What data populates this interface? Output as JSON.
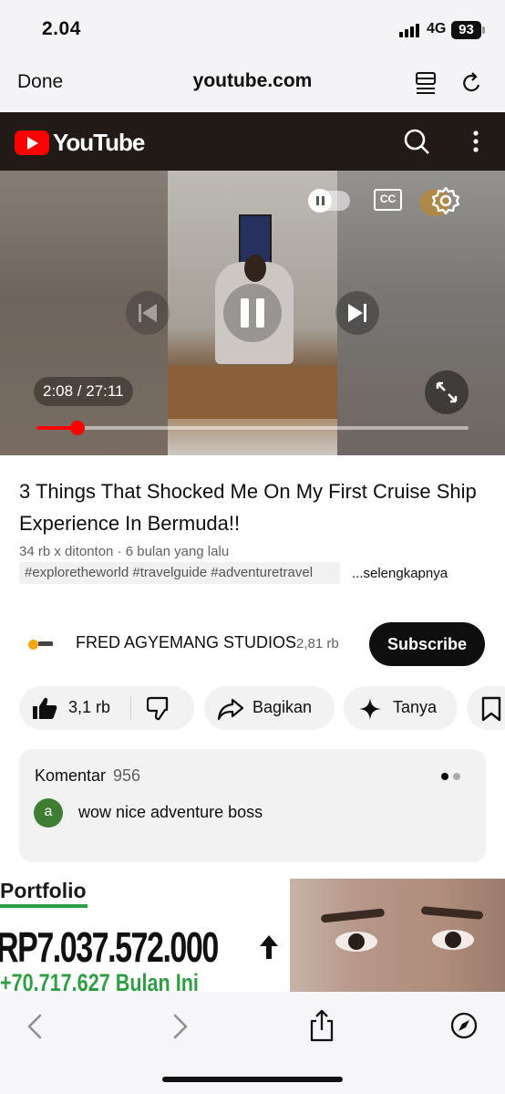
{
  "status_bar": {
    "time": "2.04",
    "network": "4G",
    "battery": "93"
  },
  "browser": {
    "done_label": "Done",
    "url": "youtube.com"
  },
  "youtube_header": {
    "logo_text": "YouTube"
  },
  "player": {
    "time_current": "2:08",
    "time_total": "27:11",
    "time_label": "2:08 / 27:11",
    "progress_fraction": 0.094,
    "cc_label": "CC",
    "accent_color": "#ff0000"
  },
  "video": {
    "title": "3 Things That Shocked Me On My First Cruise Ship Experience In Bermuda!!",
    "meta": "34 rb x ditonton · 6 bulan yang lalu",
    "tags": "#exploretheworld #travelguide #adventuretravel",
    "more_label": "...selengkapnya"
  },
  "channel": {
    "name": "FRED AGYEMANG STUDIOS",
    "subscribers": "2,81 rb",
    "subscribe_label": "Subscribe"
  },
  "actions": {
    "like_count": "3,1 rb",
    "share_label": "Bagikan",
    "ask_label": "Tanya"
  },
  "comments": {
    "title": "Komentar",
    "count": "956",
    "first_comment": {
      "avatar_letter": "a",
      "text": "wow nice adventure boss",
      "avatar_color": "#3e7d32"
    }
  },
  "ad": {
    "heading": "Portfolio",
    "amount": "RP7.037.572.000",
    "gain": "+70.717.627 Bulan Ini",
    "accent_color": "#2f9e44"
  },
  "icons": {
    "reader": "reader-icon",
    "reload": "reload-icon",
    "search": "search-icon",
    "more": "more-vert-icon",
    "settings": "gear-icon",
    "fullscreen": "fullscreen-icon",
    "like": "thumbs-up-icon",
    "dislike": "thumbs-down-icon",
    "share": "share-arrow-icon",
    "ask": "sparkle-icon",
    "save": "bookmark-icon",
    "back": "chevron-left-icon",
    "forward": "chevron-right-icon",
    "browser_share": "share-box-icon",
    "compass": "compass-icon"
  }
}
